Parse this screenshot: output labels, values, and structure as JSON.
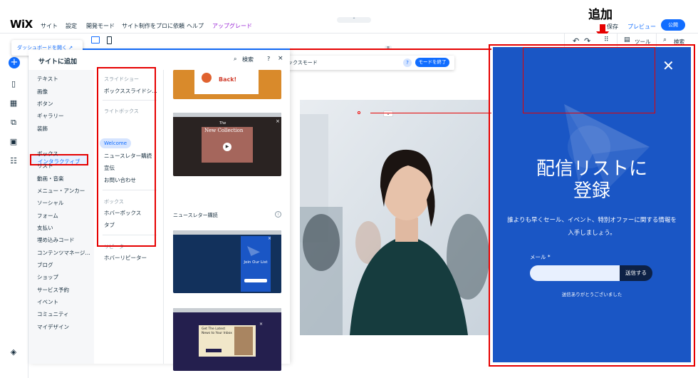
{
  "topbar": {
    "logo": "WiX",
    "menu": [
      "サイト",
      "設定",
      "開発モード",
      "サイト制作をプロに依頼",
      "ヘルプ"
    ],
    "upgrade": "アップグレード",
    "save": "保存",
    "preview": "プレビュー",
    "publish": "公開",
    "collapse": "⌃"
  },
  "annotation": {
    "add_label": "追加"
  },
  "toolbar2": {
    "tools": "ツール",
    "search": "検索"
  },
  "dashboard_tip": "ダッシュボードを開く ↗",
  "add_panel": {
    "title": "サイトに追加",
    "search": "検索",
    "help": "?",
    "close": "×",
    "categories": [
      "テキスト",
      "画像",
      "ボタン",
      "ギャラリー",
      "装飾",
      "インタラクティブ",
      "ボックス",
      "リスト",
      "動画・音楽",
      "メニュー・アンカー",
      "ソーシャル",
      "フォーム",
      "支払い",
      "埋め込みコード",
      "コンテンツマネージ…",
      "ブログ",
      "ショップ",
      "サービス予約",
      "イベント",
      "コミュニティ",
      "マイデザイン"
    ],
    "active_category": "インタラクティブ",
    "sections": {
      "slideshow": "スライドショー",
      "slideshow_item": "ボックススライドシ…",
      "lightbox": "ライトボックス",
      "lightbox_items": [
        "Welcome",
        "ニュースレター購読",
        "宣伝",
        "お問い合わせ"
      ],
      "box": "ボックス",
      "box_items": [
        "ホバーボックス",
        "タブ"
      ],
      "repeater": "リピーター",
      "repeater_item": "ホバーリピーター"
    },
    "preview_section_label": "ニュースレター購読",
    "thumbs": {
      "back": "Back!",
      "new_collection_the": "The",
      "new_collection": "New Collection",
      "join": "Join Our List",
      "latest": "Get The Latest News to Your Inbox"
    }
  },
  "mode_bar": {
    "text": "ックスモード",
    "help": "?",
    "exit": "モードを終了"
  },
  "popup": {
    "close": "✕",
    "title": "配信リストに\n登録",
    "body": "誰よりも早くセール、イベント、特別オファーに関する情報を入手しましょう。",
    "email_label": "メール *",
    "submit": "送信する",
    "thanks": "送信ありがとうございました"
  },
  "colors": {
    "accent": "#116dff",
    "popup_bg": "#1a56c5",
    "highlight": "#e60000"
  }
}
